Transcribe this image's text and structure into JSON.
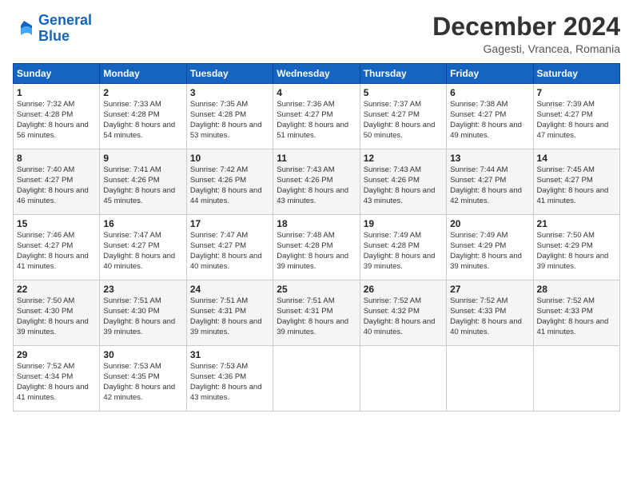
{
  "logo": {
    "line1": "General",
    "line2": "Blue"
  },
  "title": "December 2024",
  "location": "Gagesti, Vrancea, Romania",
  "days_of_week": [
    "Sunday",
    "Monday",
    "Tuesday",
    "Wednesday",
    "Thursday",
    "Friday",
    "Saturday"
  ],
  "weeks": [
    [
      {
        "day": "1",
        "sunrise": "Sunrise: 7:32 AM",
        "sunset": "Sunset: 4:28 PM",
        "daylight": "Daylight: 8 hours and 56 minutes."
      },
      {
        "day": "2",
        "sunrise": "Sunrise: 7:33 AM",
        "sunset": "Sunset: 4:28 PM",
        "daylight": "Daylight: 8 hours and 54 minutes."
      },
      {
        "day": "3",
        "sunrise": "Sunrise: 7:35 AM",
        "sunset": "Sunset: 4:28 PM",
        "daylight": "Daylight: 8 hours and 53 minutes."
      },
      {
        "day": "4",
        "sunrise": "Sunrise: 7:36 AM",
        "sunset": "Sunset: 4:27 PM",
        "daylight": "Daylight: 8 hours and 51 minutes."
      },
      {
        "day": "5",
        "sunrise": "Sunrise: 7:37 AM",
        "sunset": "Sunset: 4:27 PM",
        "daylight": "Daylight: 8 hours and 50 minutes."
      },
      {
        "day": "6",
        "sunrise": "Sunrise: 7:38 AM",
        "sunset": "Sunset: 4:27 PM",
        "daylight": "Daylight: 8 hours and 49 minutes."
      },
      {
        "day": "7",
        "sunrise": "Sunrise: 7:39 AM",
        "sunset": "Sunset: 4:27 PM",
        "daylight": "Daylight: 8 hours and 47 minutes."
      }
    ],
    [
      {
        "day": "8",
        "sunrise": "Sunrise: 7:40 AM",
        "sunset": "Sunset: 4:27 PM",
        "daylight": "Daylight: 8 hours and 46 minutes."
      },
      {
        "day": "9",
        "sunrise": "Sunrise: 7:41 AM",
        "sunset": "Sunset: 4:26 PM",
        "daylight": "Daylight: 8 hours and 45 minutes."
      },
      {
        "day": "10",
        "sunrise": "Sunrise: 7:42 AM",
        "sunset": "Sunset: 4:26 PM",
        "daylight": "Daylight: 8 hours and 44 minutes."
      },
      {
        "day": "11",
        "sunrise": "Sunrise: 7:43 AM",
        "sunset": "Sunset: 4:26 PM",
        "daylight": "Daylight: 8 hours and 43 minutes."
      },
      {
        "day": "12",
        "sunrise": "Sunrise: 7:43 AM",
        "sunset": "Sunset: 4:26 PM",
        "daylight": "Daylight: 8 hours and 43 minutes."
      },
      {
        "day": "13",
        "sunrise": "Sunrise: 7:44 AM",
        "sunset": "Sunset: 4:27 PM",
        "daylight": "Daylight: 8 hours and 42 minutes."
      },
      {
        "day": "14",
        "sunrise": "Sunrise: 7:45 AM",
        "sunset": "Sunset: 4:27 PM",
        "daylight": "Daylight: 8 hours and 41 minutes."
      }
    ],
    [
      {
        "day": "15",
        "sunrise": "Sunrise: 7:46 AM",
        "sunset": "Sunset: 4:27 PM",
        "daylight": "Daylight: 8 hours and 41 minutes."
      },
      {
        "day": "16",
        "sunrise": "Sunrise: 7:47 AM",
        "sunset": "Sunset: 4:27 PM",
        "daylight": "Daylight: 8 hours and 40 minutes."
      },
      {
        "day": "17",
        "sunrise": "Sunrise: 7:47 AM",
        "sunset": "Sunset: 4:27 PM",
        "daylight": "Daylight: 8 hours and 40 minutes."
      },
      {
        "day": "18",
        "sunrise": "Sunrise: 7:48 AM",
        "sunset": "Sunset: 4:28 PM",
        "daylight": "Daylight: 8 hours and 39 minutes."
      },
      {
        "day": "19",
        "sunrise": "Sunrise: 7:49 AM",
        "sunset": "Sunset: 4:28 PM",
        "daylight": "Daylight: 8 hours and 39 minutes."
      },
      {
        "day": "20",
        "sunrise": "Sunrise: 7:49 AM",
        "sunset": "Sunset: 4:29 PM",
        "daylight": "Daylight: 8 hours and 39 minutes."
      },
      {
        "day": "21",
        "sunrise": "Sunrise: 7:50 AM",
        "sunset": "Sunset: 4:29 PM",
        "daylight": "Daylight: 8 hours and 39 minutes."
      }
    ],
    [
      {
        "day": "22",
        "sunrise": "Sunrise: 7:50 AM",
        "sunset": "Sunset: 4:30 PM",
        "daylight": "Daylight: 8 hours and 39 minutes."
      },
      {
        "day": "23",
        "sunrise": "Sunrise: 7:51 AM",
        "sunset": "Sunset: 4:30 PM",
        "daylight": "Daylight: 8 hours and 39 minutes."
      },
      {
        "day": "24",
        "sunrise": "Sunrise: 7:51 AM",
        "sunset": "Sunset: 4:31 PM",
        "daylight": "Daylight: 8 hours and 39 minutes."
      },
      {
        "day": "25",
        "sunrise": "Sunrise: 7:51 AM",
        "sunset": "Sunset: 4:31 PM",
        "daylight": "Daylight: 8 hours and 39 minutes."
      },
      {
        "day": "26",
        "sunrise": "Sunrise: 7:52 AM",
        "sunset": "Sunset: 4:32 PM",
        "daylight": "Daylight: 8 hours and 40 minutes."
      },
      {
        "day": "27",
        "sunrise": "Sunrise: 7:52 AM",
        "sunset": "Sunset: 4:33 PM",
        "daylight": "Daylight: 8 hours and 40 minutes."
      },
      {
        "day": "28",
        "sunrise": "Sunrise: 7:52 AM",
        "sunset": "Sunset: 4:33 PM",
        "daylight": "Daylight: 8 hours and 41 minutes."
      }
    ],
    [
      {
        "day": "29",
        "sunrise": "Sunrise: 7:52 AM",
        "sunset": "Sunset: 4:34 PM",
        "daylight": "Daylight: 8 hours and 41 minutes."
      },
      {
        "day": "30",
        "sunrise": "Sunrise: 7:53 AM",
        "sunset": "Sunset: 4:35 PM",
        "daylight": "Daylight: 8 hours and 42 minutes."
      },
      {
        "day": "31",
        "sunrise": "Sunrise: 7:53 AM",
        "sunset": "Sunset: 4:36 PM",
        "daylight": "Daylight: 8 hours and 43 minutes."
      },
      null,
      null,
      null,
      null
    ]
  ]
}
